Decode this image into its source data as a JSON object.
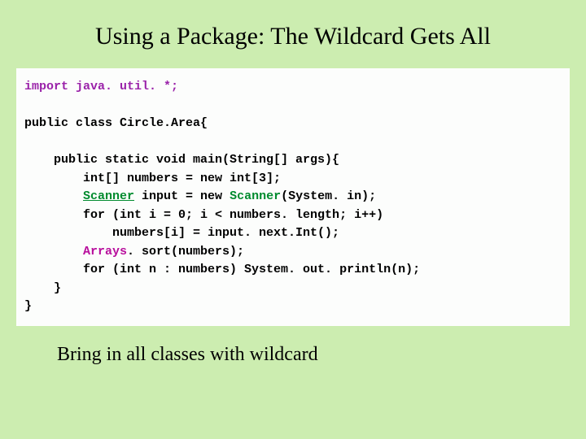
{
  "title": "Using a Package: The Wildcard Gets All",
  "code": {
    "import_line": "import java. util. *;",
    "blank1": "",
    "class_line": "public class Circle.Area{",
    "blank2": "",
    "main_sig": "    public static void main(String[] args){",
    "l_numbers": "        int[] numbers = new int[3];",
    "l_scanner_pre": "        ",
    "l_scanner_kw1": "Scanner",
    "l_scanner_mid": " input = new ",
    "l_scanner_kw2": "Scanner",
    "l_scanner_post": "(System. in);",
    "l_for1": "        for (int i = 0; i < numbers. length; i++)",
    "l_assign": "            numbers[i] = input. next.Int();",
    "l_arrays_pre": "        ",
    "l_arrays_kw": "Arrays",
    "l_arrays_post": ". sort(numbers);",
    "l_for2": "        for (int n : numbers) System. out. println(n);",
    "l_close_main": "    }",
    "l_close_class": "}"
  },
  "caption": "Bring in all classes with wildcard"
}
